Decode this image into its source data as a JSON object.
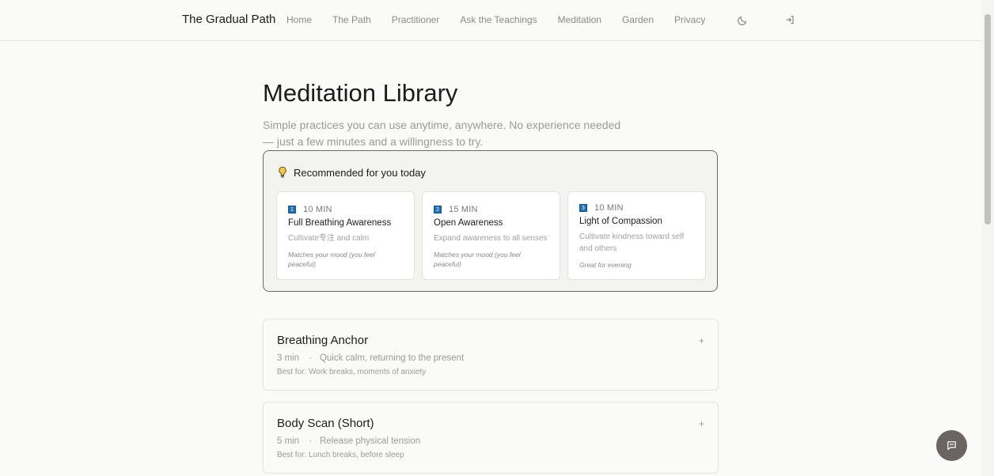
{
  "nav": {
    "brand": "The Gradual Path",
    "links": [
      "Home",
      "The Path",
      "Practitioner",
      "Ask the Teachings",
      "Meditation",
      "Garden",
      "Privacy"
    ],
    "theme_icon": "moon-icon",
    "login_icon": "login-icon"
  },
  "header": {
    "title": "Meditation Library",
    "subtitle": "Simple practices you can use anytime, anywhere. No experience needed — just a few minutes and a willingness to try."
  },
  "recommended": {
    "icon": "lightbulb-icon",
    "heading": "Recommended for you today",
    "cards": [
      {
        "badge": "1",
        "duration": "10 MIN",
        "title": "Full Breathing Awareness",
        "description": "Cultivate专注 and calm",
        "note": "Matches your mood (you feel peaceful)"
      },
      {
        "badge": "2",
        "duration": "15 MIN",
        "title": "Open Awareness",
        "description": "Expand awareness to all senses",
        "note": "Matches your mood (you feel peaceful)"
      },
      {
        "badge": "3",
        "duration": "10 MIN",
        "title": "Light of Compassion",
        "description": "Cultivate kindness toward self and others",
        "note": "Great for evening"
      }
    ]
  },
  "meditations": [
    {
      "title": "Breathing Anchor",
      "duration": "3 min",
      "separator": "·",
      "summary": "Quick calm, returning to the present",
      "best_for": "Best for: Work breaks, moments of anxiety",
      "expand": "+"
    },
    {
      "title": "Body Scan (Short)",
      "duration": "5 min",
      "separator": "·",
      "summary": "Release physical tension",
      "best_for": "Best for: Lunch breaks, before sleep",
      "expand": "+"
    }
  ],
  "chat_button": {
    "icon": "chat-icon"
  },
  "colors": {
    "background": "#fafaf8",
    "badge": "#1f6fb0",
    "fab": "#6b6562"
  }
}
